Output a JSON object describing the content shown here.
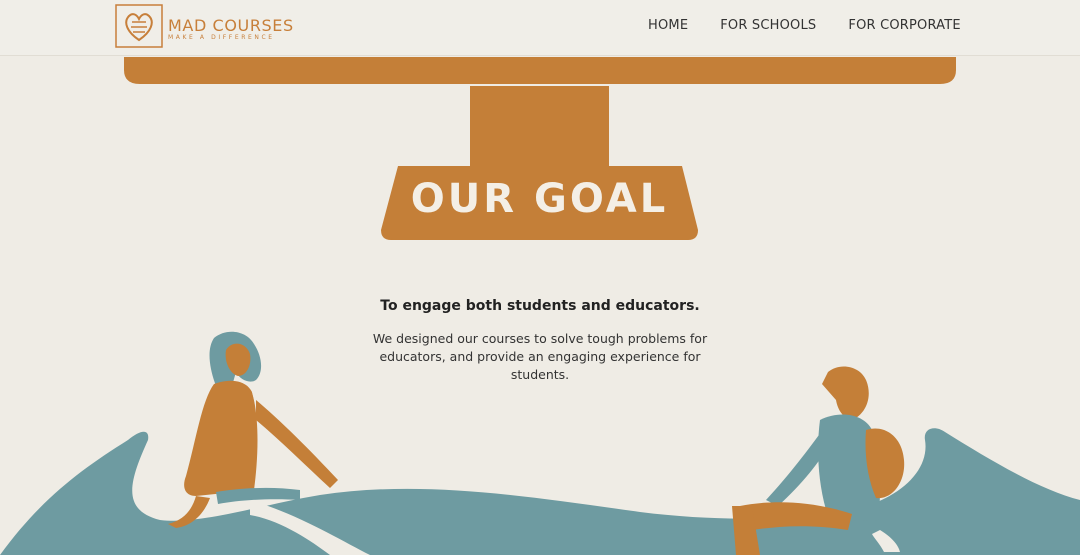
{
  "brand": {
    "name": "MAD COURSES",
    "tagline": "MAKE A DIFFERENCE",
    "color": "#c77f3a"
  },
  "nav": {
    "items": [
      {
        "label": "HOME"
      },
      {
        "label": "FOR SCHOOLS"
      },
      {
        "label": "FOR CORPORATE"
      }
    ]
  },
  "hero": {
    "sign_text": "OUR GOAL",
    "headline": "To engage both students and educators.",
    "paragraph": "We designed our courses to solve tough problems for educators, and provide an engaging experience for students."
  },
  "colors": {
    "background": "#efece5",
    "accent_orange": "#c77f3a",
    "teal": "#6d9aa0",
    "sign_text": "#f4efe6"
  }
}
